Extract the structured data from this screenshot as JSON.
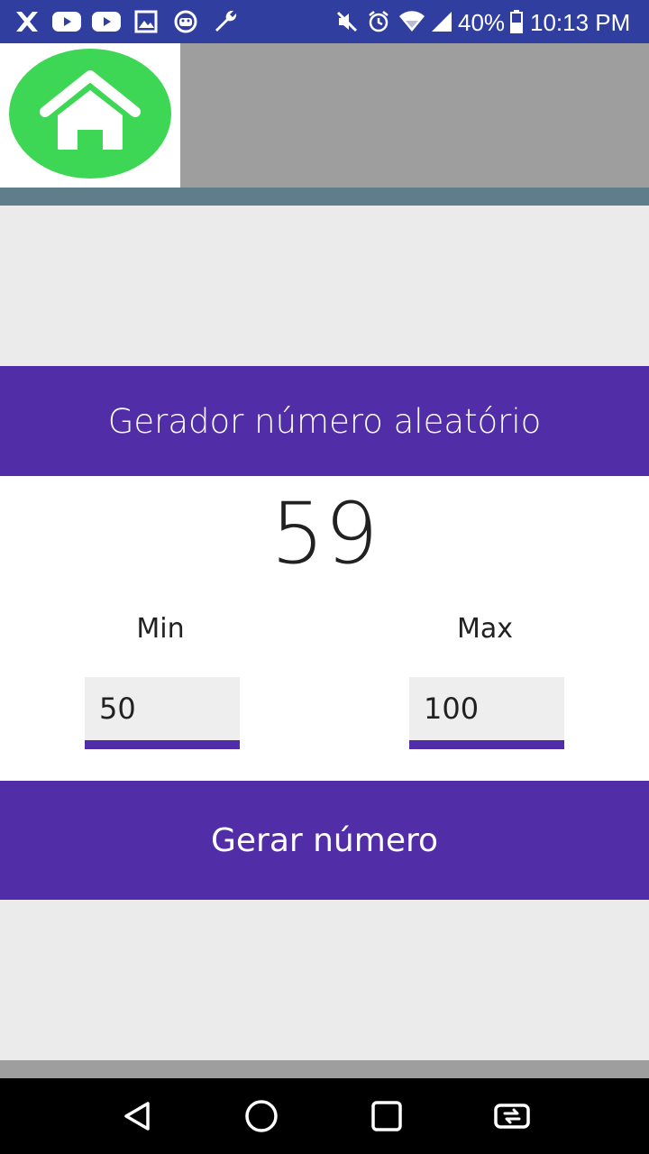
{
  "status_bar": {
    "left_icons": [
      "x-app-icon",
      "youtube-icon",
      "youtube-icon",
      "image-icon",
      "android-icon",
      "wrench-icon"
    ],
    "right_icons": [
      "mute-icon",
      "alarm-icon",
      "wifi-icon",
      "signal-icon"
    ],
    "battery_percent": "40%",
    "time": "10:13 PM"
  },
  "header": {
    "logo_icon": "home-icon",
    "colors": {
      "logo_green": "#3dd655",
      "header_gray": "#9e9e9e",
      "stripe": "#607d8b"
    }
  },
  "main": {
    "title": "Gerador número aleatório",
    "result": "59",
    "min_label": "Min",
    "max_label": "Max",
    "min_value": "50",
    "max_value": "100",
    "generate_button": "Gerar número"
  },
  "nav_bar": {
    "buttons": [
      "back-icon",
      "home-circle-icon",
      "recents-icon",
      "rotate-icon"
    ]
  },
  "colors": {
    "accent": "#512da8",
    "status_bar": "#303f9f"
  }
}
